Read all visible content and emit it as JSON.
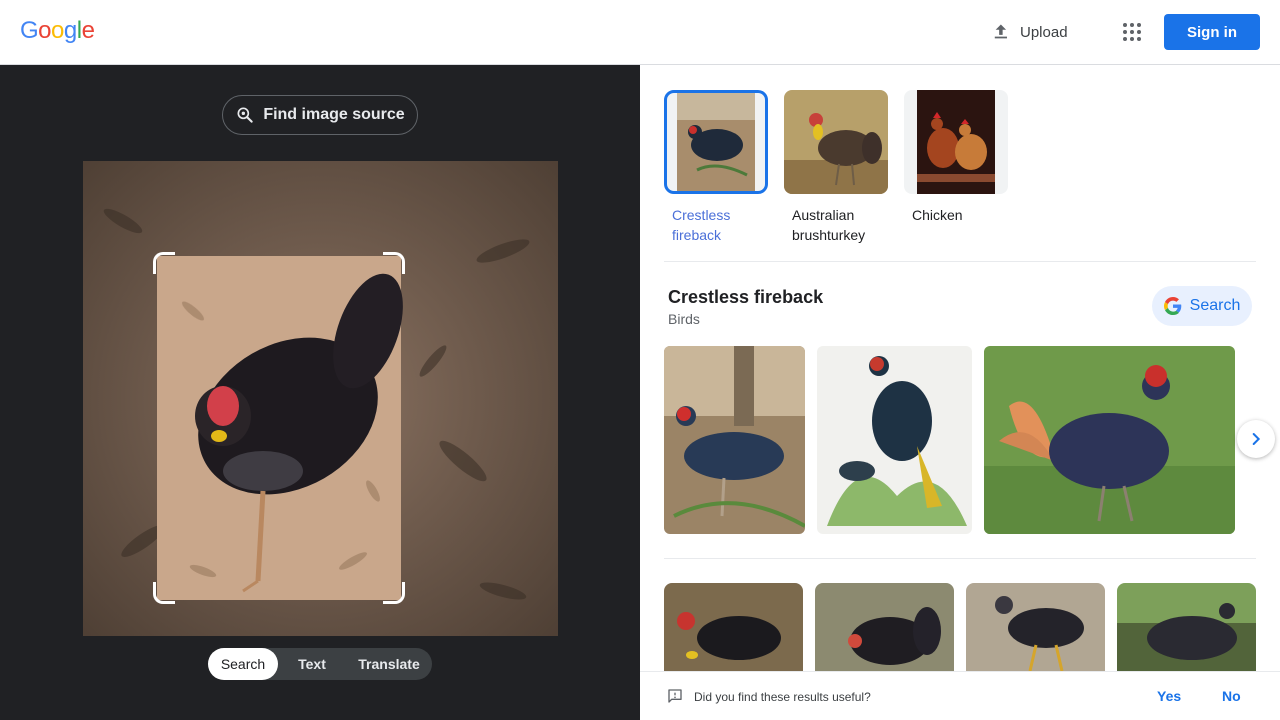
{
  "header": {
    "logo_letters": [
      "G",
      "o",
      "o",
      "g",
      "l",
      "e"
    ],
    "logo_colors": [
      "#4285f4",
      "#ea4335",
      "#fbbc05",
      "#4285f4",
      "#34a853",
      "#ea4335"
    ],
    "upload_label": "Upload",
    "signin_label": "Sign in"
  },
  "left": {
    "find_source_label": "Find image source",
    "mode_tabs": [
      "Search",
      "Text",
      "Translate"
    ],
    "active_tab": "Search"
  },
  "chips": [
    {
      "label": "Crestless fireback",
      "selected": true
    },
    {
      "label": "Australian brushturkey",
      "selected": false
    },
    {
      "label": "Chicken",
      "selected": false
    }
  ],
  "entity": {
    "title": "Crestless fireback",
    "subtitle": "Birds",
    "search_label": "Search"
  },
  "feedback": {
    "question": "Did you find these results useful?",
    "yes_label": "Yes",
    "no_label": "No"
  },
  "colors": {
    "accent": "#1a73e8",
    "dark_panel": "#202124"
  }
}
